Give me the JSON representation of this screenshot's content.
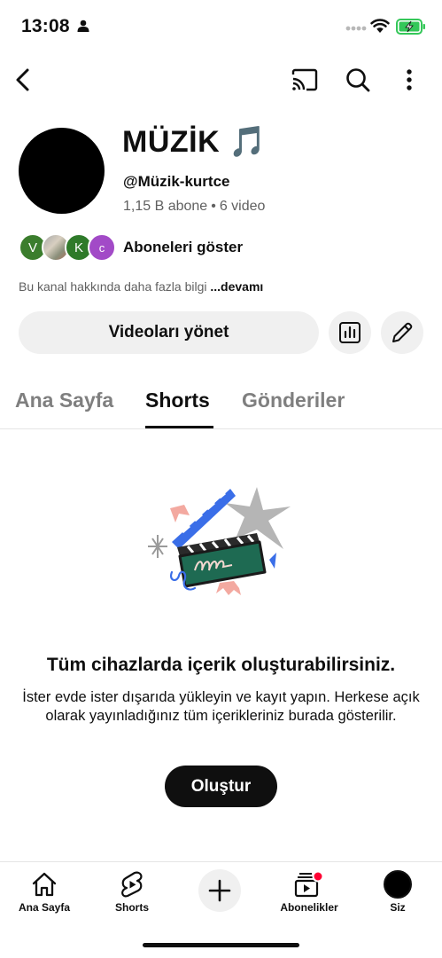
{
  "status_bar": {
    "time": "13:08"
  },
  "top_bar": {
    "icons": [
      "back-icon",
      "cast-icon",
      "search-icon",
      "more-vert-icon"
    ]
  },
  "channel": {
    "name": "MÜZİK 🎵",
    "handle": "@Müzik-kurtce",
    "subscribers": "1,15 B abone",
    "separator": "•",
    "videos": "6 video",
    "sub_avatars": [
      "V",
      "",
      "K",
      "c"
    ],
    "show_subscribers": "Aboneleri göster",
    "about_text": "Bu kanal hakkında daha fazla bilgi",
    "about_more": "...devamı"
  },
  "actions": {
    "manage_videos": "Videoları yönet"
  },
  "tabs": [
    {
      "label": "Ana Sayfa",
      "active": false
    },
    {
      "label": "Shorts",
      "active": true
    },
    {
      "label": "Gönderiler",
      "active": false
    }
  ],
  "empty_state": {
    "title": "Tüm cihazlarda içerik oluşturabilirsiniz.",
    "body": "İster evde ister dışarıda yükleyin ve kayıt yapın. Herkese açık olarak yayınladığınız tüm içerikleriniz burada gösterilir.",
    "button": "Oluştur"
  },
  "bottom_nav": [
    {
      "label": "Ana Sayfa",
      "icon": "home-icon"
    },
    {
      "label": "Shorts",
      "icon": "shorts-icon"
    },
    {
      "label": "",
      "icon": "plus-icon"
    },
    {
      "label": "Abonelikler",
      "icon": "subscriptions-icon"
    },
    {
      "label": "Siz",
      "icon": "avatar-icon"
    }
  ],
  "colors": {
    "text": "#0f0f0f",
    "secondary": "#606060",
    "chip": "#f0f0f0",
    "notification": "#ff0033",
    "battery": "#34c759"
  }
}
